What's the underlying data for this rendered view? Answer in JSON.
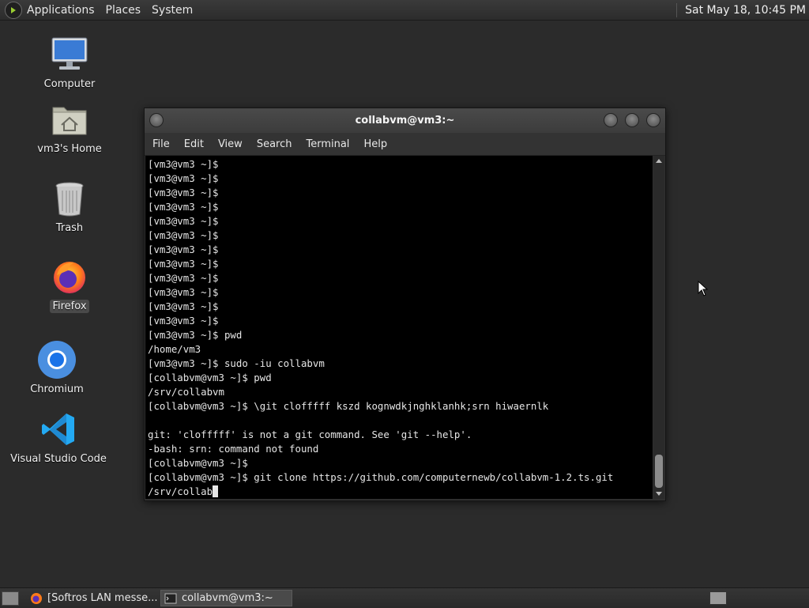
{
  "top_panel": {
    "menus": [
      "Applications",
      "Places",
      "System"
    ],
    "clock": "Sat May 18, 10:45 PM"
  },
  "desktop_icons": [
    {
      "label": "Computer",
      "icon": "computer-icon"
    },
    {
      "label": "vm3's Home",
      "icon": "home-folder-icon"
    },
    {
      "label": "Trash",
      "icon": "trash-icon"
    },
    {
      "label": "Firefox",
      "icon": "firefox-icon"
    },
    {
      "label": "Chromium",
      "icon": "chromium-icon"
    },
    {
      "label": "Visual Studio Code",
      "icon": "vscode-icon"
    }
  ],
  "terminal": {
    "title": "collabvm@vm3:~",
    "menu": [
      "File",
      "Edit",
      "View",
      "Search",
      "Terminal",
      "Help"
    ],
    "lines": [
      "[vm3@vm3 ~]$",
      "[vm3@vm3 ~]$",
      "[vm3@vm3 ~]$",
      "[vm3@vm3 ~]$",
      "[vm3@vm3 ~]$",
      "[vm3@vm3 ~]$",
      "[vm3@vm3 ~]$",
      "[vm3@vm3 ~]$",
      "[vm3@vm3 ~]$",
      "[vm3@vm3 ~]$",
      "[vm3@vm3 ~]$",
      "[vm3@vm3 ~]$",
      "[vm3@vm3 ~]$ pwd",
      "/home/vm3",
      "[vm3@vm3 ~]$ sudo -iu collabvm",
      "[collabvm@vm3 ~]$ pwd",
      "/srv/collabvm",
      "[collabvm@vm3 ~]$ \\git clofffff kszd kognwdkjnghklanhk;srn hiwaernlk",
      "",
      "git: 'clofffff' is not a git command. See 'git --help'.",
      "-bash: srn: command not found",
      "[collabvm@vm3 ~]$",
      "[collabvm@vm3 ~]$ git clone https://github.com/computernewb/collabvm-1.2.ts.git",
      "/srv/collab"
    ]
  },
  "taskbar": {
    "tasks": [
      {
        "label": "[Softros LAN messe...",
        "icon": "firefox-icon",
        "active": false
      },
      {
        "label": "collabvm@vm3:~",
        "icon": "terminal-icon",
        "active": true
      }
    ]
  }
}
